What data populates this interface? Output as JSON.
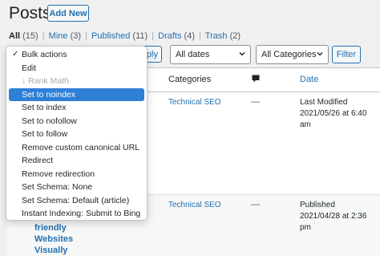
{
  "header": {
    "title": "Posts",
    "add_new_label": "Add New"
  },
  "views": [
    {
      "label": "All",
      "count": "(15)"
    },
    {
      "label": "Mine",
      "count": "(3)"
    },
    {
      "label": "Published",
      "count": "(11)"
    },
    {
      "label": "Drafts",
      "count": "(4)"
    },
    {
      "label": "Trash",
      "count": "(2)"
    }
  ],
  "filters": {
    "apply_label": "ply",
    "dates_value": "All dates",
    "categories_value": "All Categories",
    "filter_label": "Filter"
  },
  "table": {
    "columns": {
      "categories": "Categories",
      "date": "Date"
    },
    "rows": [
      {
        "category": "Technical SEO",
        "comments": "—",
        "date_status": "Last Modified",
        "date_value": "2021/05/26 at 6:40",
        "date_time": "am"
      },
      {
        "category": "Technical SEO",
        "comments": "—",
        "date_status": "Published",
        "date_value": "2021/04/28 at 2:36",
        "date_time": "pm",
        "title_fragment": [
          "friendly",
          "Websites",
          "Visually"
        ]
      }
    ]
  },
  "bulk_actions": {
    "items": [
      {
        "label": "Bulk actions",
        "state": "checked"
      },
      {
        "label": "Edit",
        "state": "normal"
      },
      {
        "label": "↓ Rank Math",
        "state": "disabled"
      },
      {
        "label": "Set to noindex",
        "state": "selected"
      },
      {
        "label": "Set to index",
        "state": "normal"
      },
      {
        "label": "Set to nofollow",
        "state": "normal"
      },
      {
        "label": "Set to follow",
        "state": "normal"
      },
      {
        "label": "Remove custom canonical URL",
        "state": "normal"
      },
      {
        "label": "Redirect",
        "state": "normal"
      },
      {
        "label": "Remove redirection",
        "state": "normal"
      },
      {
        "label": "Set Schema: None",
        "state": "normal"
      },
      {
        "label": "Set Schema: Default (article)",
        "state": "normal"
      },
      {
        "label": "Instant Indexing: Submit to Bing",
        "state": "normal"
      }
    ]
  },
  "icons": {
    "comments": "comment-bubble-icon",
    "select_arrow": "chevron-down-icon",
    "check": "checkmark-icon"
  },
  "colors": {
    "link": "#2271b1",
    "highlight": "#2f7fd6",
    "background": "#f0f0f1"
  }
}
